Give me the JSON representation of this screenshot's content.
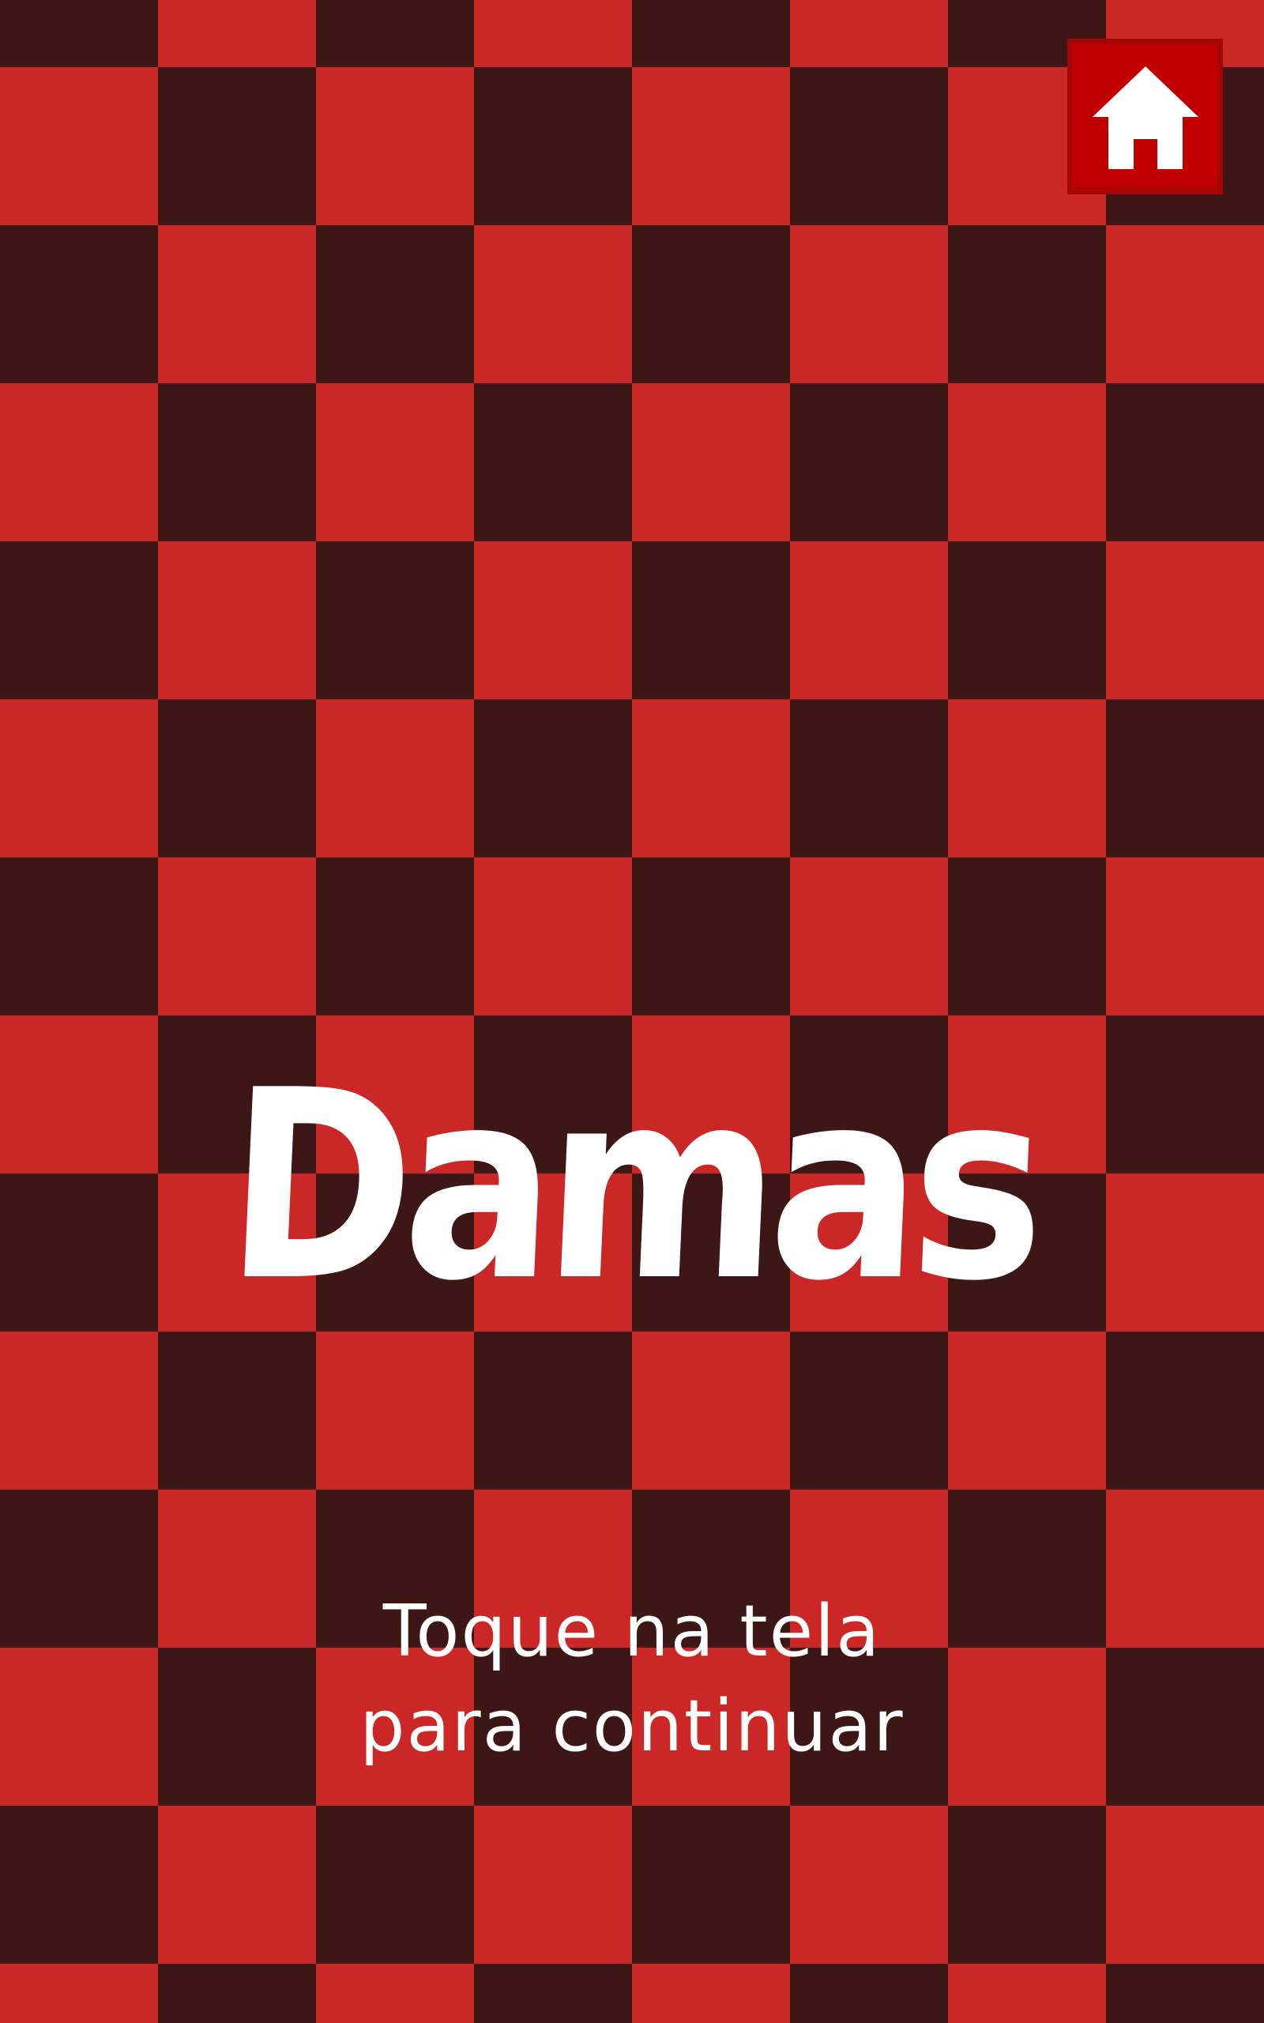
{
  "screen": {
    "title": "Damas",
    "tap_hint": {
      "line1": "Toque na tela",
      "line2": "para continuar"
    }
  },
  "home_button": {
    "icon": "home-icon"
  },
  "colors": {
    "board_light": "#cc2727",
    "board_dark": "#3d1716",
    "button_bg": "#c00000",
    "button_border": "#a40606",
    "text": "#ffffff"
  }
}
